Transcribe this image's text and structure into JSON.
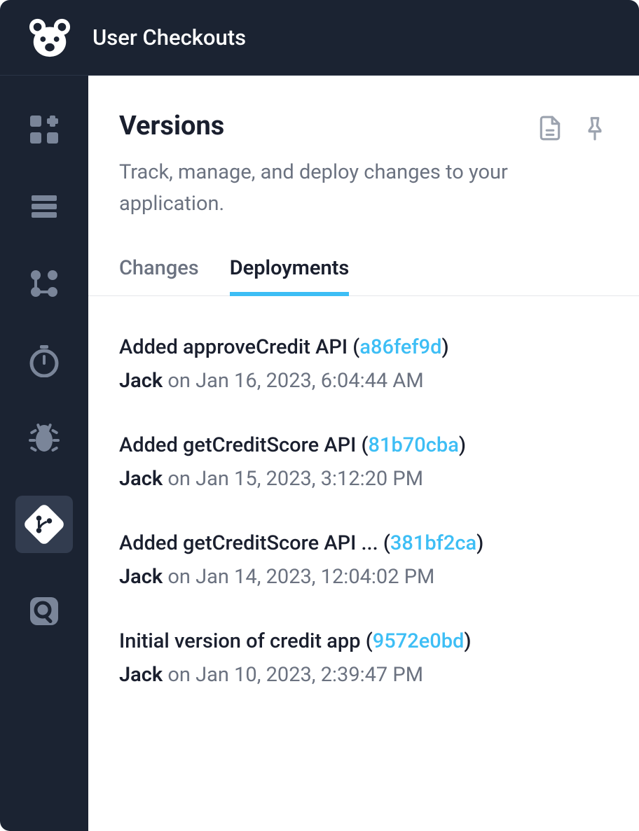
{
  "header": {
    "title": "User Checkouts"
  },
  "page": {
    "title": "Versions",
    "subtitle": "Track, manage, and deploy changes to your application."
  },
  "tabs": [
    {
      "label": "Changes",
      "active": false
    },
    {
      "label": "Deployments",
      "active": true
    }
  ],
  "deployments": [
    {
      "title": "Added approveCredit API",
      "hash": "a86fef9d",
      "author": "Jack",
      "timestamp": "on Jan 16, 2023, 6:04:44 AM"
    },
    {
      "title": "Added getCreditScore API",
      "hash": "81b70cba",
      "author": "Jack",
      "timestamp": "on Jan 15, 2023, 3:12:20 PM"
    },
    {
      "title": "Added getCreditScore API ...",
      "hash": "381bf2ca",
      "author": "Jack",
      "timestamp": "on Jan 14, 2023, 12:04:02 PM"
    },
    {
      "title": "Initial version of credit app",
      "hash": "9572e0bd",
      "author": "Jack",
      "timestamp": "on Jan 10, 2023, 2:39:47 PM"
    }
  ]
}
